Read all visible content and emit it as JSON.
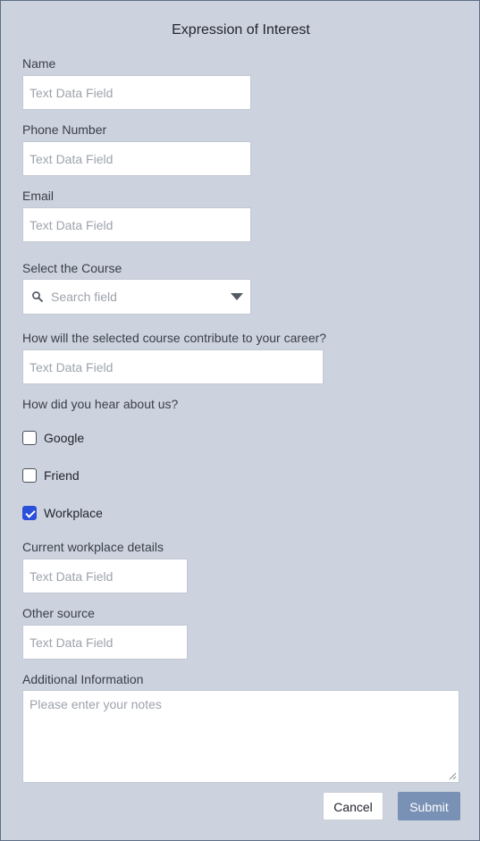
{
  "form": {
    "title": "Expression of Interest",
    "name": {
      "label": "Name",
      "placeholder": "Text Data Field"
    },
    "phone": {
      "label": "Phone Number",
      "placeholder": "Text Data Field"
    },
    "email": {
      "label": "Email",
      "placeholder": "Text Data Field"
    },
    "course": {
      "label": "Select the Course",
      "placeholder": "Search field",
      "icon": "search-icon"
    },
    "career": {
      "label": "How will the selected course contribute to your career?",
      "placeholder": "Text Data Field"
    },
    "hear": {
      "label": "How did you hear about us?",
      "options": [
        {
          "label": "Google",
          "checked": false
        },
        {
          "label": "Friend",
          "checked": false
        },
        {
          "label": "Workplace",
          "checked": true
        }
      ]
    },
    "workplace": {
      "label": "Current workplace details",
      "placeholder": "Text Data Field"
    },
    "other": {
      "label": "Other source",
      "placeholder": "Text Data Field"
    },
    "notes": {
      "label": "Additional Information",
      "placeholder": "Please enter your notes"
    },
    "buttons": {
      "cancel": "Cancel",
      "submit": "Submit"
    }
  },
  "colors": {
    "background": "#ccd3df",
    "accent": "#2a4fd8",
    "submit": "#7891b5"
  }
}
